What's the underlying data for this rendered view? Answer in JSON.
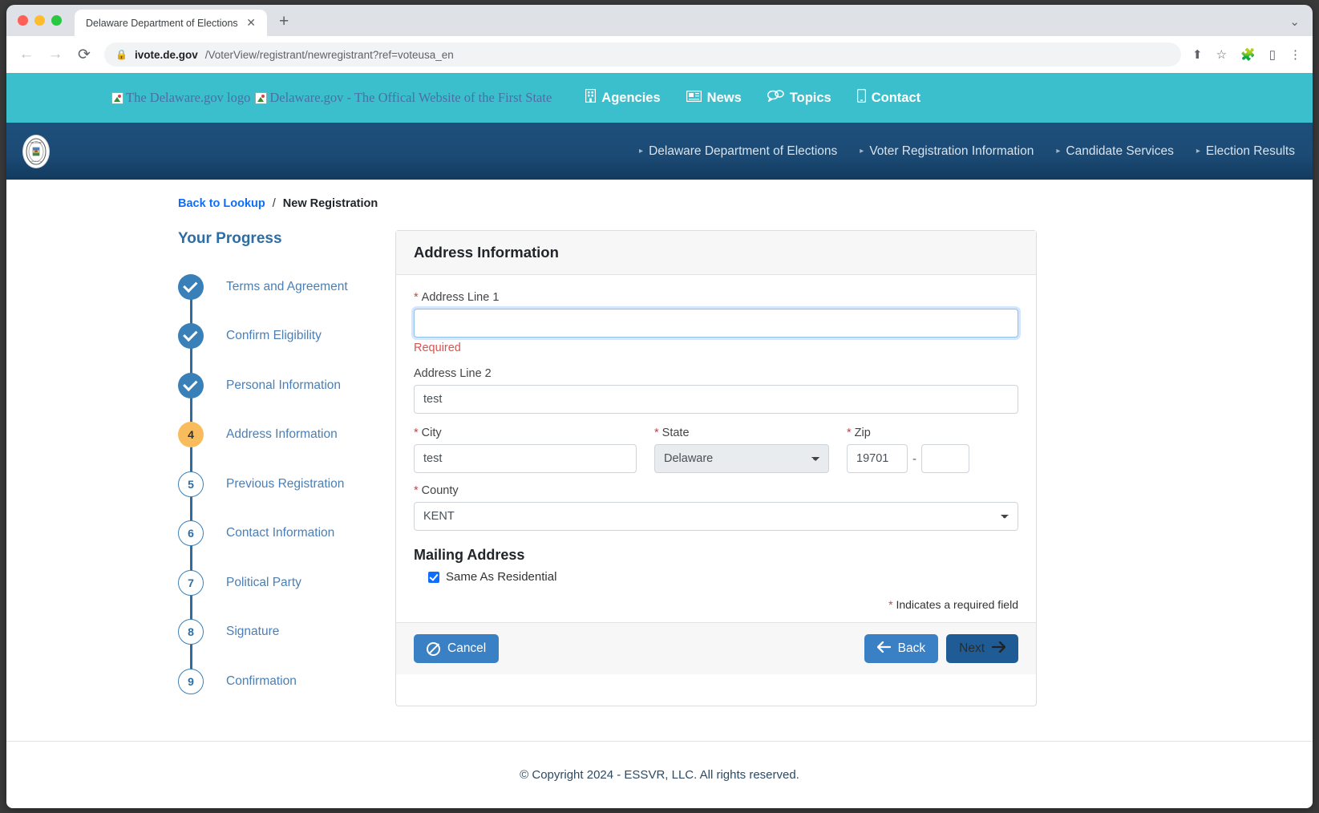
{
  "browser": {
    "tab_title": "Delaware Department of Elections",
    "tab_close": "✕",
    "new_tab": "+",
    "back_icon": "←",
    "forward_icon": "→",
    "reload_icon": "⟳",
    "lock_icon": "🔒",
    "url_host": "ivote.de.gov",
    "url_path": "/VoterView/registrant/newregistrant?ref=voteusa_en",
    "share_icon": "⬆",
    "star_icon": "☆",
    "extensions_icon": "🧩",
    "sidepanel_icon": "▯",
    "menu_icon": "⋮",
    "window_controls_icon": "⌄"
  },
  "degov": {
    "logo_alt": "The Delaware.gov logo",
    "site_alt": "Delaware.gov - The Offical Website of the First State",
    "nav": [
      {
        "label": "Agencies",
        "icon": "building-icon"
      },
      {
        "label": "News",
        "icon": "newspaper-icon"
      },
      {
        "label": "Topics",
        "icon": "chat-icon"
      },
      {
        "label": "Contact",
        "icon": "phone-icon"
      }
    ]
  },
  "agency_nav": {
    "seal_name": "delaware-state-seal",
    "links": [
      "Delaware Department of Elections",
      "Voter Registration Information",
      "Candidate Services",
      "Election Results"
    ],
    "caret": "▸"
  },
  "breadcrumb": {
    "back_link": "Back to Lookup",
    "separator": "/",
    "current": "New Registration"
  },
  "progress": {
    "title": "Your Progress",
    "steps": [
      {
        "num": "1",
        "label": "Terms and Agreement",
        "state": "done"
      },
      {
        "num": "2",
        "label": "Confirm Eligibility",
        "state": "done"
      },
      {
        "num": "3",
        "label": "Personal Information",
        "state": "done"
      },
      {
        "num": "4",
        "label": "Address Information",
        "state": "active"
      },
      {
        "num": "5",
        "label": "Previous Registration",
        "state": "todo"
      },
      {
        "num": "6",
        "label": "Contact Information",
        "state": "todo"
      },
      {
        "num": "7",
        "label": "Political Party",
        "state": "todo"
      },
      {
        "num": "8",
        "label": "Signature",
        "state": "todo"
      },
      {
        "num": "9",
        "label": "Confirmation",
        "state": "todo"
      }
    ]
  },
  "form": {
    "card_title": "Address Information",
    "address1": {
      "label": "Address Line 1",
      "value": "",
      "error": "Required",
      "required": true
    },
    "address2": {
      "label": "Address Line 2",
      "value": "test",
      "required": false
    },
    "city": {
      "label": "City",
      "value": "test",
      "required": true
    },
    "state": {
      "label": "State",
      "value": "Delaware",
      "required": true
    },
    "zip": {
      "label": "Zip",
      "value": "19701",
      "plus4": "",
      "dash": "-",
      "required": true
    },
    "county": {
      "label": "County",
      "value": "KENT",
      "required": true
    },
    "mailing_heading": "Mailing Address",
    "same_as_residential": {
      "label": "Same As Residential",
      "checked": true
    },
    "required_note_star": "*",
    "required_note": " Indicates a required field"
  },
  "buttons": {
    "cancel": {
      "label": "Cancel",
      "icon": "ban-icon"
    },
    "back": {
      "label": "Back",
      "icon": "arrow-left-icon"
    },
    "next": {
      "label": "Next",
      "icon": "arrow-right-icon",
      "disabled": true
    }
  },
  "footer": {
    "copyright": "© Copyright 2024 - ESSVR, LLC. All rights reserved."
  },
  "colors": {
    "teal": "#3cbfcd",
    "agency_blue": "#1e4f7c",
    "accent_blue": "#3a80b8",
    "active_step": "#f9bc5d",
    "error_red": "#d9534f",
    "link_blue": "#0d6efd"
  }
}
